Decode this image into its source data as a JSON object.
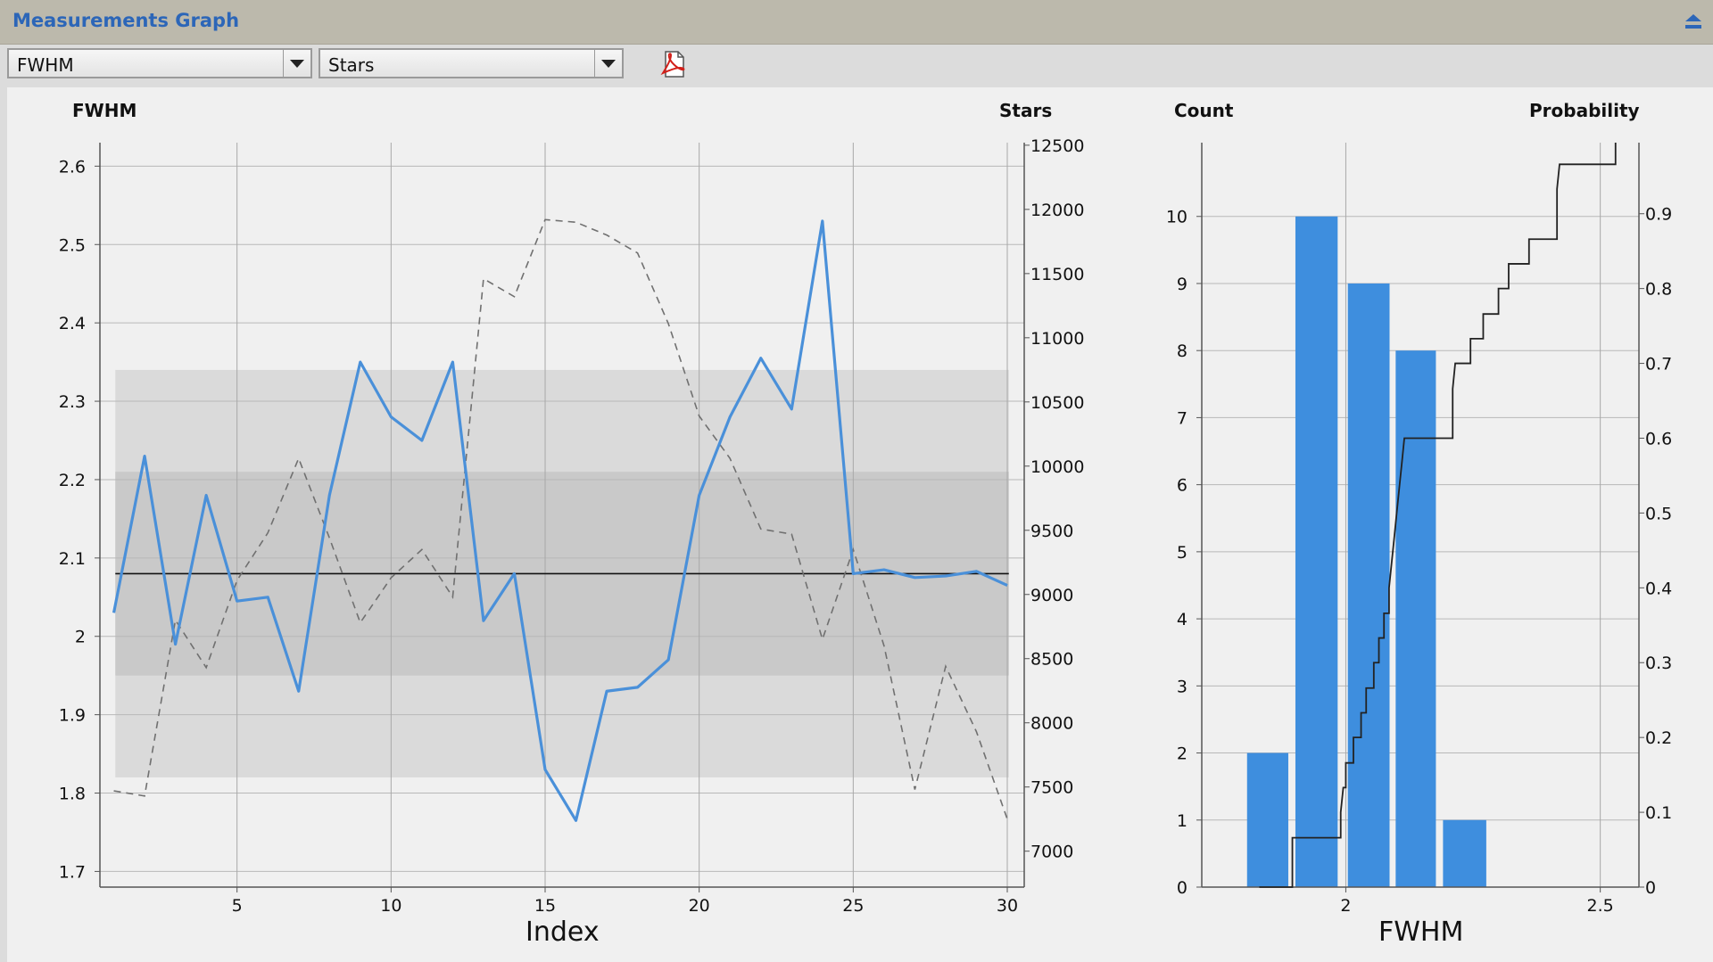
{
  "header": {
    "title": "Measurements Graph"
  },
  "toolbar": {
    "metric_value": "FWHM",
    "overlay_value": "Stars"
  },
  "colors": {
    "accent": "#2c66b8",
    "series": "#4a90d9",
    "bar": "#3e8ede"
  },
  "icons": {
    "collapse": "collapse-up-icon",
    "pdf": "pdf-export-icon"
  },
  "left_chart": {
    "ylabel_left": "FWHM",
    "ylabel_right": "Stars",
    "xlabel": "Index",
    "yticks_left": [
      "1.7",
      "1.8",
      "1.9",
      "2",
      "2.1",
      "2.2",
      "2.3",
      "2.4",
      "2.5",
      "2.6"
    ],
    "yticks_right": [
      "7000",
      "7500",
      "8000",
      "8500",
      "9000",
      "9500",
      "10000",
      "10500",
      "11000",
      "11500",
      "12000",
      "12500"
    ],
    "xticks": [
      "5",
      "10",
      "15",
      "20",
      "25",
      "30"
    ]
  },
  "right_chart": {
    "ylabel_left": "Count",
    "ylabel_right": "Probability",
    "xlabel": "FWHM",
    "yticks_left": [
      "0",
      "1",
      "2",
      "3",
      "4",
      "5",
      "6",
      "7",
      "8",
      "9",
      "10"
    ],
    "yticks_right": [
      "0",
      "0.1",
      "0.2",
      "0.3",
      "0.4",
      "0.5",
      "0.6",
      "0.7",
      "0.8",
      "0.9"
    ],
    "xticks": [
      "2",
      "2.5"
    ]
  },
  "chart_data": [
    {
      "type": "line",
      "xlabel": "Index",
      "ylabel": "FWHM",
      "y2label": "Stars",
      "x": [
        1,
        2,
        3,
        4,
        5,
        6,
        7,
        8,
        9,
        10,
        11,
        12,
        13,
        14,
        15,
        16,
        17,
        18,
        19,
        20,
        21,
        22,
        23,
        24,
        25,
        26,
        27,
        28,
        29,
        30
      ],
      "series": [
        {
          "axis": "left",
          "values": [
            2.03,
            2.23,
            1.99,
            2.18,
            2.045,
            2.05,
            1.93,
            2.18,
            2.35,
            2.28,
            2.25,
            2.35,
            2.02,
            2.08,
            1.83,
            1.765,
            1.93,
            1.935,
            1.97,
            2.18,
            2.28,
            2.355,
            2.29,
            2.53,
            2.08,
            2.085,
            2.075,
            2.077,
            2.083,
            2.065
          ]
        },
        {
          "axis": "right",
          "values": [
            7470,
            7430,
            8800,
            8430,
            9110,
            9480,
            10060,
            9440,
            8780,
            9130,
            9350,
            8980,
            11460,
            11320,
            11920,
            11900,
            11800,
            11660,
            11110,
            10390,
            10060,
            9510,
            9470,
            8650,
            9350,
            8600,
            7480,
            8440,
            7930,
            7250
          ]
        }
      ],
      "mean_line": 2.08,
      "band_inner": [
        1.95,
        2.21
      ],
      "band_outer": [
        1.82,
        2.34
      ],
      "ylim": [
        1.68,
        2.63
      ],
      "y2lim": [
        6720,
        12520
      ],
      "xlim": [
        0.55,
        30.55
      ],
      "grid": true
    },
    {
      "type": "bar",
      "xlabel": "FWHM",
      "ylabel": "Count",
      "y2label": "Probability",
      "bins": [
        [
          1.806,
          1.887
        ],
        [
          1.901,
          1.984
        ],
        [
          2.004,
          2.086
        ],
        [
          2.098,
          2.177
        ],
        [
          2.191,
          2.276
        ]
      ],
      "values": [
        2,
        10,
        9,
        8,
        1
      ],
      "cdf": [
        [
          1.83,
          0
        ],
        [
          1.895,
          0
        ],
        [
          1.895,
          0.066
        ],
        [
          1.99,
          0.066
        ],
        [
          1.99,
          0.1
        ],
        [
          1.995,
          0.133
        ],
        [
          2.0,
          0.133
        ],
        [
          2.0,
          0.166
        ],
        [
          2.015,
          0.166
        ],
        [
          2.015,
          0.2
        ],
        [
          2.03,
          0.2
        ],
        [
          2.03,
          0.233
        ],
        [
          2.04,
          0.233
        ],
        [
          2.04,
          0.266
        ],
        [
          2.055,
          0.266
        ],
        [
          2.055,
          0.3
        ],
        [
          2.065,
          0.3
        ],
        [
          2.065,
          0.333
        ],
        [
          2.075,
          0.333
        ],
        [
          2.075,
          0.366
        ],
        [
          2.085,
          0.366
        ],
        [
          2.085,
          0.4
        ],
        [
          2.09,
          0.433
        ],
        [
          2.095,
          0.466
        ],
        [
          2.1,
          0.5
        ],
        [
          2.105,
          0.533
        ],
        [
          2.11,
          0.566
        ],
        [
          2.115,
          0.6
        ],
        [
          2.21,
          0.6
        ],
        [
          2.21,
          0.666
        ],
        [
          2.215,
          0.7
        ],
        [
          2.245,
          0.7
        ],
        [
          2.245,
          0.733
        ],
        [
          2.27,
          0.733
        ],
        [
          2.27,
          0.766
        ],
        [
          2.3,
          0.766
        ],
        [
          2.3,
          0.8
        ],
        [
          2.32,
          0.8
        ],
        [
          2.32,
          0.833
        ],
        [
          2.36,
          0.833
        ],
        [
          2.36,
          0.866
        ],
        [
          2.415,
          0.866
        ],
        [
          2.415,
          0.933
        ],
        [
          2.42,
          0.966
        ],
        [
          2.53,
          0.966
        ],
        [
          2.53,
          1.0
        ]
      ],
      "xlim": [
        1.717,
        2.576
      ],
      "ylim": [
        0,
        11.1
      ],
      "y2lim": [
        0,
        0.995
      ],
      "grid": true
    }
  ]
}
